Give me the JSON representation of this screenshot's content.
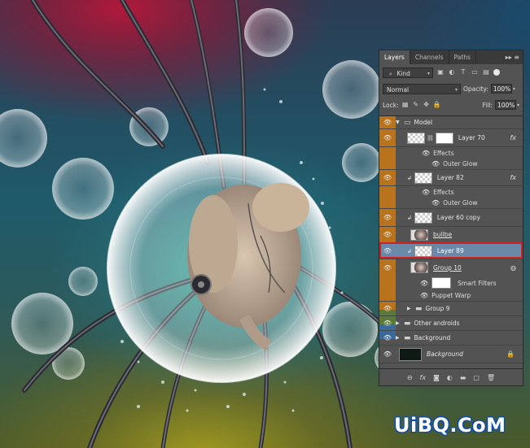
{
  "app": {
    "name": "Photoshop"
  },
  "panel": {
    "tabs": [
      {
        "label": "Layers",
        "active": true
      },
      {
        "label": "Channels",
        "active": false
      },
      {
        "label": "Paths",
        "active": false
      }
    ],
    "menu_glyph": "▸▸ ≡",
    "filter": {
      "value": "Kind"
    },
    "blend_mode": {
      "value": "Normal"
    },
    "opacity": {
      "label": "Opacity:",
      "value": "100%"
    },
    "lock": {
      "label": "Lock:"
    },
    "fill": {
      "label": "Fill:",
      "value": "100%"
    },
    "layers": [
      {
        "name": "Model",
        "type": "group-open"
      },
      {
        "name": "Layer 70",
        "type": "layer",
        "fx": "fx"
      },
      {
        "name": "Effects",
        "type": "effects"
      },
      {
        "name": "Outer Glow",
        "type": "effect"
      },
      {
        "name": "Layer 82",
        "type": "layer",
        "fx": "fx"
      },
      {
        "name": "Effects",
        "type": "effects"
      },
      {
        "name": "Outer Glow",
        "type": "effect"
      },
      {
        "name": "Layer 60 copy",
        "type": "layer"
      },
      {
        "name": "bullbe",
        "type": "layer"
      },
      {
        "name": "Layer 89",
        "type": "layer",
        "selected": true
      },
      {
        "name": "Group 10",
        "type": "smart"
      },
      {
        "name": "Smart Filters",
        "type": "smart-filters"
      },
      {
        "name": "Puppet Warp",
        "type": "filter"
      },
      {
        "name": "Group 9",
        "type": "group-closed"
      },
      {
        "name": "Other androids",
        "type": "group-closed"
      },
      {
        "name": "Background",
        "type": "group-closed"
      },
      {
        "name": "Background",
        "type": "background"
      }
    ]
  },
  "footer": {
    "link": "⊖",
    "fx": "fx",
    "mask": "◙",
    "adjust": "◐",
    "group": "▬",
    "new": "▢",
    "delete": "🗑"
  },
  "colors": {
    "panel_bg": "#535353",
    "group_label_orange": "#b8731c",
    "group_label_green": "#5a7a36",
    "group_label_blue": "#3a6a9a",
    "selected_row": "#6a88a8",
    "selection_outline": "#d42020"
  },
  "watermark": {
    "text": "UiBQ.CoM"
  }
}
